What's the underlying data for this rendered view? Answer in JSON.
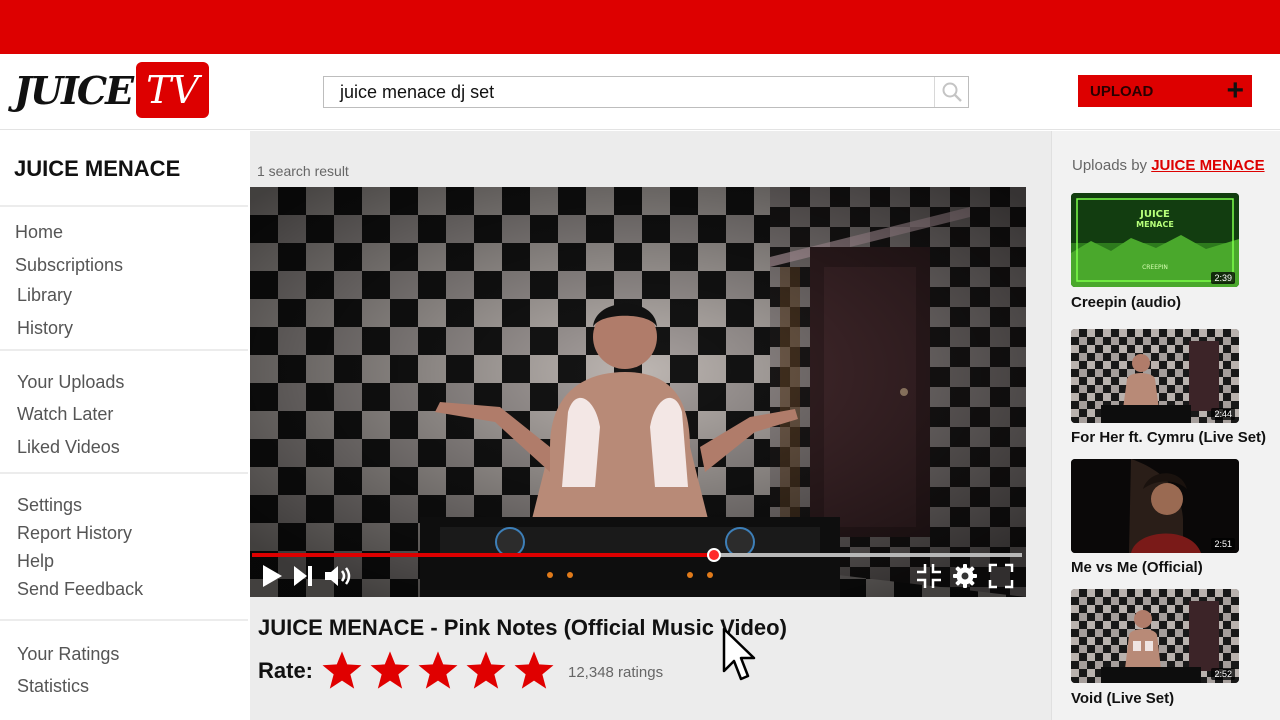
{
  "header": {
    "logo_juice": "JUICE",
    "logo_tv": "TV",
    "search_value": "juice menace dj set",
    "upload_label": "UPLOAD"
  },
  "sidebar": {
    "channel_name": "JUICE MENACE",
    "groups": [
      [
        "Home",
        "Subscriptions",
        "Library",
        "History"
      ],
      [
        "Your Uploads",
        "Watch Later",
        "Liked Videos"
      ],
      [
        "Settings",
        "Report History",
        "Help",
        "Send Feedback"
      ],
      [
        "Your Ratings",
        "Statistics"
      ]
    ]
  },
  "main": {
    "result_count": "1 search result",
    "video_title": "JUICE MENACE - Pink Notes (Official Music Video)",
    "progress": 0.6,
    "rate_label": "Rate:",
    "stars_filled": 5,
    "stars_total": 5,
    "ratings_count": "12,348 ratings"
  },
  "rightbar": {
    "uploads_by_prefix": "Uploads by",
    "uploads_by_channel": "JUICE MENACE",
    "videos": [
      {
        "title": "Creepin (audio)",
        "duration": "2:39"
      },
      {
        "title": "For Her ft. Cymru (Live Set)",
        "duration": "2:44"
      },
      {
        "title": "Me vs Me (Official)",
        "duration": "2:51"
      },
      {
        "title": "Void (Live Set)",
        "duration": "2:52"
      }
    ]
  },
  "colors": {
    "brand_red": "#dd0000",
    "star_red": "#e00000"
  }
}
